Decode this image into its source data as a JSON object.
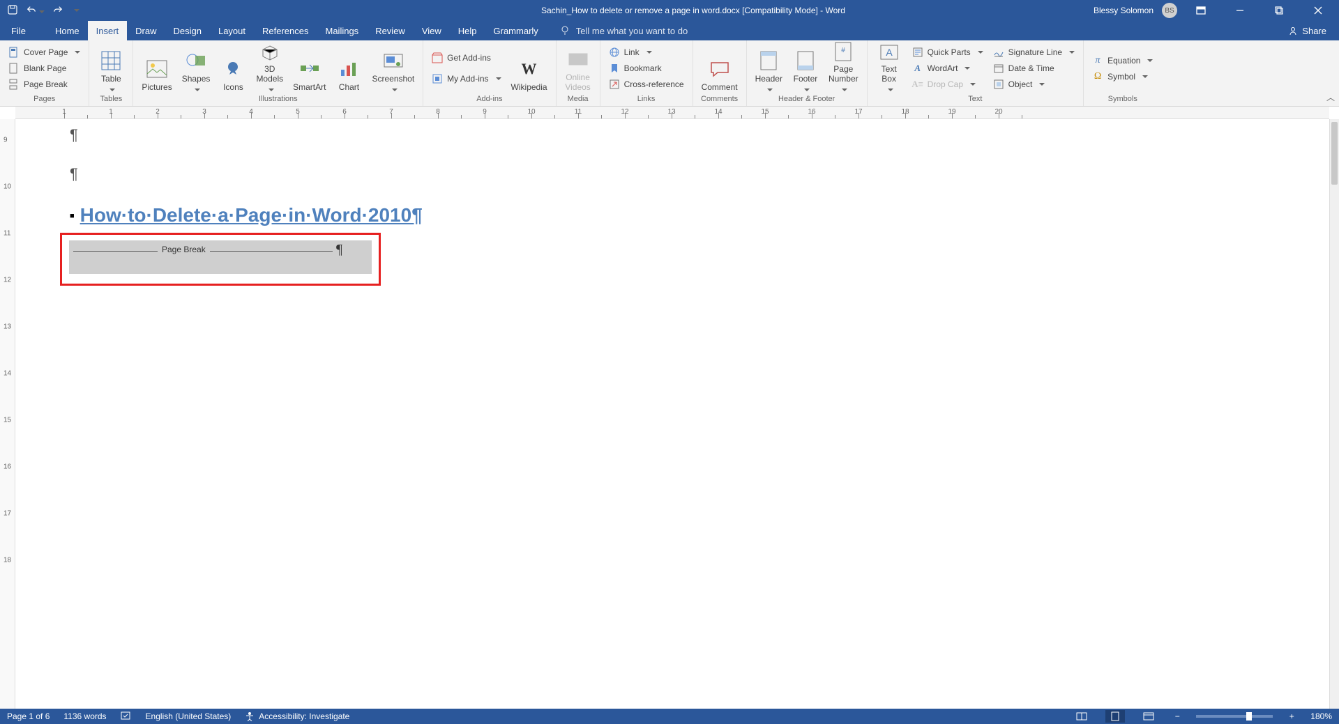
{
  "title": "Sachin_How to delete or remove a page in word.docx [Compatibility Mode]  -  Word",
  "user": {
    "name": "Blessy Solomon",
    "initials": "BS"
  },
  "share": "Share",
  "tabs": [
    "File",
    "Home",
    "Insert",
    "Draw",
    "Design",
    "Layout",
    "References",
    "Mailings",
    "Review",
    "View",
    "Help",
    "Grammarly"
  ],
  "active_tab": "Insert",
  "tellme": "Tell me what you want to do",
  "ribbon": {
    "pages": {
      "label": "Pages",
      "cover": "Cover Page",
      "blank": "Blank Page",
      "break": "Page Break"
    },
    "tables": {
      "label": "Tables",
      "table": "Table"
    },
    "illustrations": {
      "label": "Illustrations",
      "pictures": "Pictures",
      "shapes": "Shapes",
      "icons": "Icons",
      "models": "3D\nModels",
      "smartart": "SmartArt",
      "chart": "Chart",
      "screenshot": "Screenshot"
    },
    "addins": {
      "label": "Add-ins",
      "get": "Get Add-ins",
      "my": "My Add-ins",
      "wiki": "Wikipedia"
    },
    "media": {
      "label": "Media",
      "video": "Online\nVideos"
    },
    "links": {
      "label": "Links",
      "link": "Link",
      "bookmark": "Bookmark",
      "xref": "Cross-reference"
    },
    "comments": {
      "label": "Comments",
      "comment": "Comment"
    },
    "hf": {
      "label": "Header & Footer",
      "header": "Header",
      "footer": "Footer",
      "pagenum": "Page\nNumber"
    },
    "text": {
      "label": "Text",
      "textbox": "Text\nBox",
      "quick": "Quick Parts",
      "wordart": "WordArt",
      "dropcap": "Drop Cap",
      "sigline": "Signature Line",
      "datetime": "Date & Time",
      "object": "Object"
    },
    "symbols": {
      "label": "Symbols",
      "equation": "Equation",
      "symbol": "Symbol"
    }
  },
  "doc": {
    "heading": "How·to·Delete·a·Page·in·Word·2010¶",
    "pagebreak_label": "Page Break"
  },
  "hruler": [
    1,
    1,
    2,
    3,
    4,
    5,
    6,
    7,
    8,
    9,
    10,
    11,
    12,
    13,
    14,
    15,
    16,
    17,
    18,
    19,
    20
  ],
  "vruler": [
    9,
    10,
    11,
    12,
    13,
    14,
    15,
    16,
    17,
    18
  ],
  "status": {
    "page": "Page 1 of 6",
    "words": "1136 words",
    "lang": "English (United States)",
    "access": "Accessibility: Investigate",
    "zoom": "180%"
  }
}
